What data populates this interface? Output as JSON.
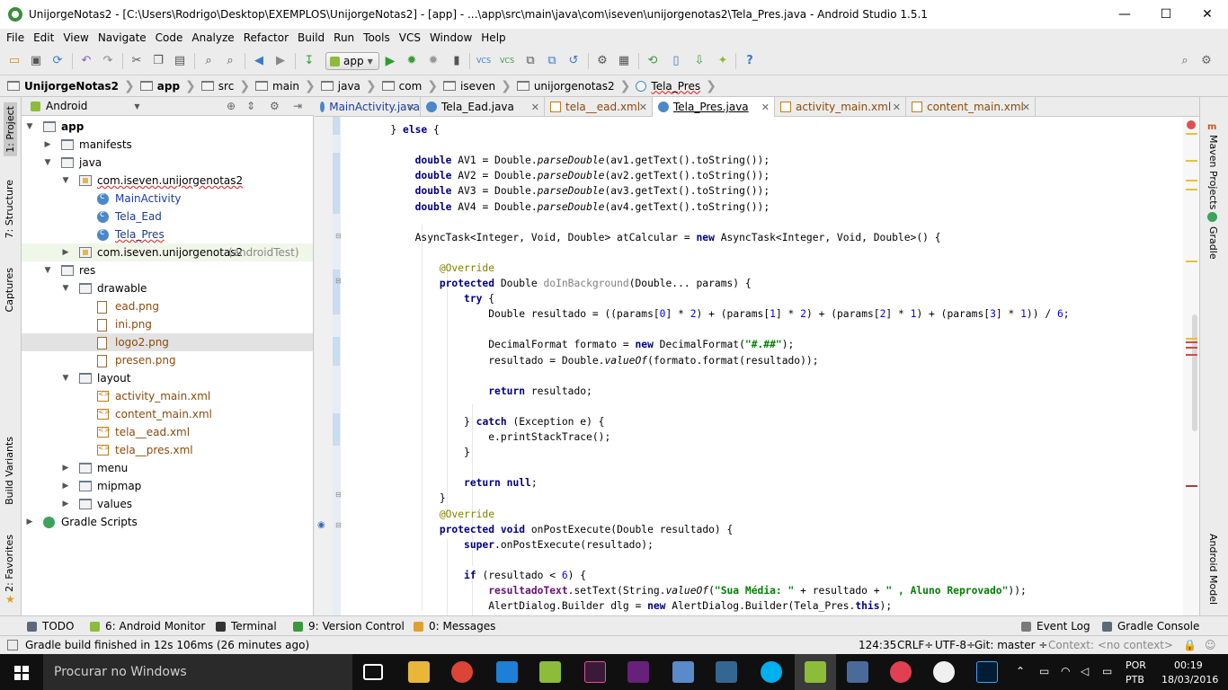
{
  "window": {
    "title": "UnijorgeNotas2 - [C:\\Users\\Rodrigo\\Desktop\\EXEMPLOS\\UnijorgeNotas2] - [app] - ...\\app\\src\\main\\java\\com\\iseven\\unijorgenotas2\\Tela_Pres.java - Android Studio 1.5.1",
    "minimize": "—",
    "maximize": "☐",
    "close": "✕"
  },
  "menu": [
    "File",
    "Edit",
    "View",
    "Navigate",
    "Code",
    "Analyze",
    "Refactor",
    "Build",
    "Run",
    "Tools",
    "VCS",
    "Window",
    "Help"
  ],
  "toolbar": {
    "run_config": "app"
  },
  "breadcrumb": [
    "UnijorgeNotas2",
    "app",
    "src",
    "main",
    "java",
    "com",
    "iseven",
    "unijorgenotas2",
    "Tela_Pres"
  ],
  "project_panel": {
    "view": "Android",
    "tree": [
      {
        "label": "app",
        "depth": 0,
        "type": "folder",
        "bold": true
      },
      {
        "label": "manifests",
        "depth": 1,
        "type": "folder"
      },
      {
        "label": "java",
        "depth": 1,
        "type": "folder"
      },
      {
        "label": "com.iseven.unijorgenotas2",
        "depth": 2,
        "type": "pkg"
      },
      {
        "label": "MainActivity",
        "depth": 3,
        "type": "cls"
      },
      {
        "label": "Tela_Ead",
        "depth": 3,
        "type": "cls"
      },
      {
        "label": "Tela_Pres",
        "depth": 3,
        "type": "cls"
      },
      {
        "label": "com.iseven.unijorgenotas2",
        "suffix": "(androidTest)",
        "depth": 2,
        "type": "pkg"
      },
      {
        "label": "res",
        "depth": 1,
        "type": "folder"
      },
      {
        "label": "drawable",
        "depth": 2,
        "type": "folder"
      },
      {
        "label": "ead.png",
        "depth": 3,
        "type": "img"
      },
      {
        "label": "ini.png",
        "depth": 3,
        "type": "img"
      },
      {
        "label": "logo2.png",
        "depth": 3,
        "type": "img"
      },
      {
        "label": "presen.png",
        "depth": 3,
        "type": "img"
      },
      {
        "label": "layout",
        "depth": 2,
        "type": "folder"
      },
      {
        "label": "activity_main.xml",
        "depth": 3,
        "type": "xml"
      },
      {
        "label": "content_main.xml",
        "depth": 3,
        "type": "xml"
      },
      {
        "label": "tela__ead.xml",
        "depth": 3,
        "type": "xml"
      },
      {
        "label": "tela__pres.xml",
        "depth": 3,
        "type": "xml"
      },
      {
        "label": "menu",
        "depth": 2,
        "type": "folder"
      },
      {
        "label": "mipmap",
        "depth": 2,
        "type": "folder"
      },
      {
        "label": "values",
        "depth": 2,
        "type": "folder"
      },
      {
        "label": "Gradle Scripts",
        "depth": 0,
        "type": "gradle"
      }
    ]
  },
  "editor_tabs": [
    {
      "label": "MainActivity.java",
      "kind": "java"
    },
    {
      "label": "Tela_Ead.java",
      "kind": "java"
    },
    {
      "label": "tela__ead.xml",
      "kind": "xml"
    },
    {
      "label": "Tela_Pres.java",
      "kind": "java",
      "active": true
    },
    {
      "label": "activity_main.xml",
      "kind": "xml"
    },
    {
      "label": "content_main.xml",
      "kind": "xml"
    }
  ],
  "code_lines": [
    "        } else {",
    "",
    "            double AV1 = Double.parseDouble(av1.getText().toString());",
    "            double AV2 = Double.parseDouble(av2.getText().toString());",
    "            double AV3 = Double.parseDouble(av3.getText().toString());",
    "            double AV4 = Double.parseDouble(av4.getText().toString());",
    "",
    "            AsyncTask<Integer, Void, Double> atCalcular = new AsyncTask<Integer, Void, Double>() {",
    "",
    "                @Override",
    "                protected Double doInBackground(Double... params) {",
    "                    try {",
    "                        Double resultado = ((params[0] * 2) + (params[1] * 2) + (params[2] * 1) + (params[3] * 1)) / 6;",
    "",
    "                        DecimalFormat formato = new DecimalFormat(\"#.##\");",
    "                        resultado = Double.valueOf(formato.format(resultado));",
    "",
    "                        return resultado;",
    "",
    "                    } catch (Exception e) {",
    "                        e.printStackTrace();",
    "                    }",
    "",
    "                    return null;",
    "                }",
    "                @Override",
    "                protected void onPostExecute(Double resultado) {",
    "                    super.onPostExecute(resultado);",
    "",
    "                    if (resultado < 6) {",
    "                        resultadoText.setText(String.valueOf(\"Sua Média: \" + resultado + \" , Aluno Reprovado\"));",
    "                        AlertDialog.Builder dlg = new AlertDialog.Builder(Tela_Pres.this);"
  ],
  "left_tool_tabs": [
    "1: Project",
    "7: Structure",
    "Captures",
    "Build Variants",
    "2: Favorites"
  ],
  "right_tool_tabs": [
    "Maven Projects",
    "Gradle",
    "Android Model"
  ],
  "bottom_tabs": {
    "todo": "TODO",
    "android_monitor": "6: Android Monitor",
    "terminal": "Terminal",
    "version_control": "9: Version Control",
    "messages": "0: Messages",
    "event_log": "Event Log",
    "gradle_console": "Gradle Console"
  },
  "status": {
    "message": "Gradle build finished in 12s 106ms (26 minutes ago)",
    "position": "124:35",
    "line_sep": "CRLF÷",
    "encoding": "UTF-8÷",
    "vcs": "Git: master ÷",
    "context": "Context: <no context>"
  },
  "taskbar": {
    "search_placeholder": "Procurar no Windows",
    "lang": "POR",
    "layout": "PTB",
    "time": "00:19",
    "date": "18/03/2016"
  }
}
